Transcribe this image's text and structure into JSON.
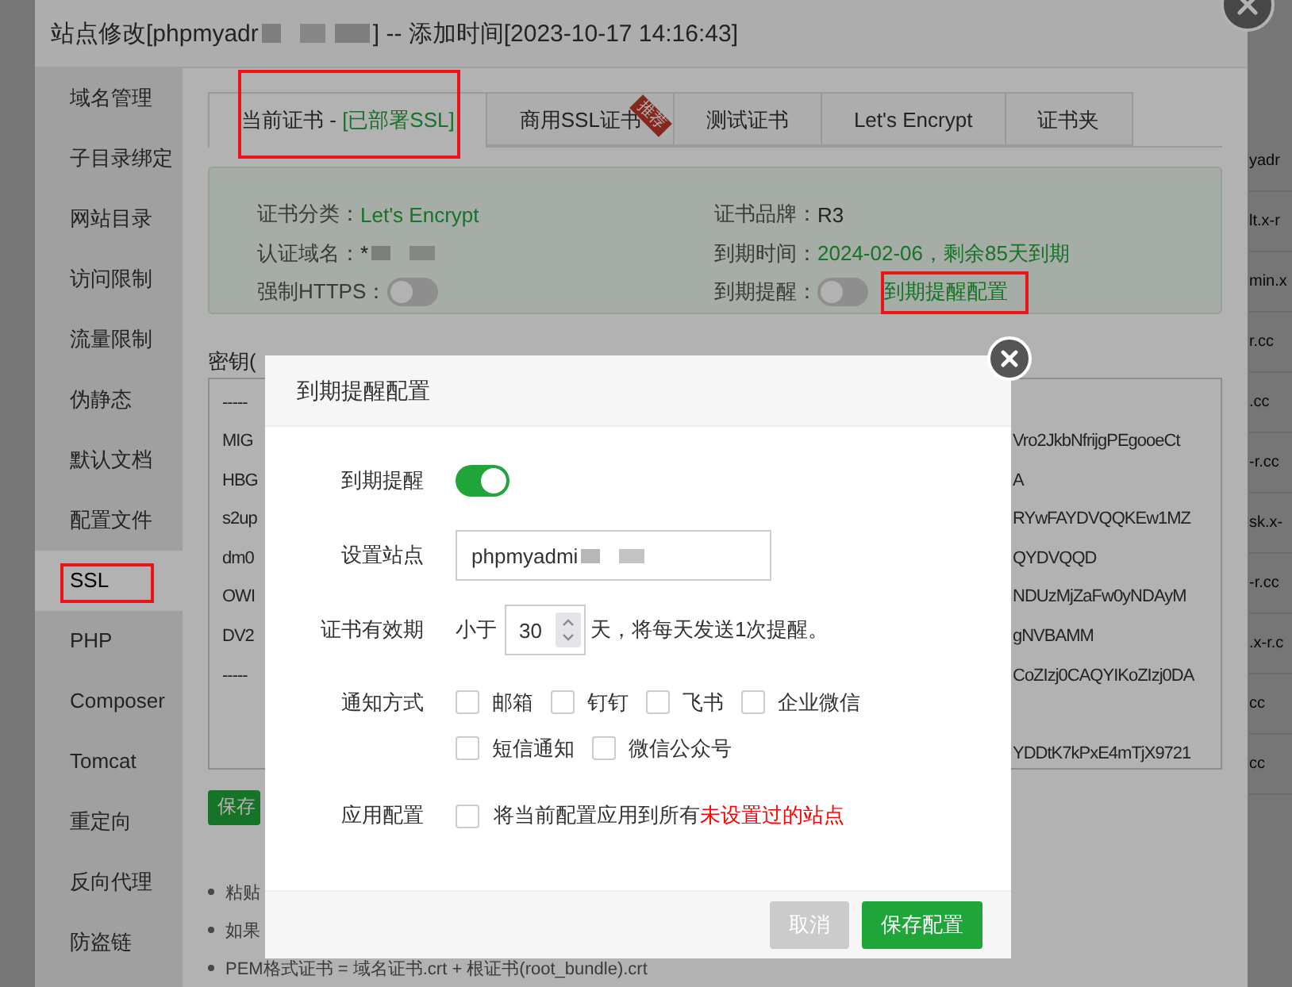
{
  "background_table": {
    "cells": [
      "yadr",
      "lt.x-r",
      "min.x",
      "r.cc",
      ".cc",
      "-r.cc",
      "sk.x-",
      "-r.cc",
      ".x-r.c",
      "cc",
      "cc"
    ]
  },
  "site_dialog": {
    "title": "站点修改[phpmyadr",
    "title_tail": "] -- 添加时间[2023-10-17 14:16:43]",
    "sidebar": {
      "items": [
        {
          "label": "域名管理",
          "selected": false
        },
        {
          "label": "子目录绑定",
          "selected": false
        },
        {
          "label": "网站目录",
          "selected": false
        },
        {
          "label": "访问限制",
          "selected": false
        },
        {
          "label": "流量限制",
          "selected": false
        },
        {
          "label": "伪静态",
          "selected": false
        },
        {
          "label": "默认文档",
          "selected": false
        },
        {
          "label": "配置文件",
          "selected": false
        },
        {
          "label": "SSL",
          "selected": true
        },
        {
          "label": "PHP",
          "selected": false
        },
        {
          "label": "Composer",
          "selected": false
        },
        {
          "label": "Tomcat",
          "selected": false
        },
        {
          "label": "重定向",
          "selected": false
        },
        {
          "label": "反向代理",
          "selected": false
        },
        {
          "label": "防盗链",
          "selected": false
        }
      ]
    },
    "tabs": [
      {
        "label": "当前证书 - ",
        "status": "[已部署SSL]",
        "selected": true
      },
      {
        "label": "商用SSL证书",
        "badge": "推荐",
        "selected": false
      },
      {
        "label": "测试证书",
        "selected": false
      },
      {
        "label": "Let's Encrypt",
        "selected": false
      },
      {
        "label": "证书夹",
        "selected": false
      }
    ],
    "cert_info": {
      "fields": [
        {
          "kind": "status",
          "label": "证书分类：",
          "value": "Let's Encrypt"
        },
        {
          "kind": "plain",
          "label": "证书品牌：",
          "value": "R3"
        },
        {
          "kind": "masked",
          "label": "认证域名：",
          "value": "*"
        },
        {
          "kind": "status",
          "label": "到期时间：",
          "value": "2024-02-06，剩余85天到期"
        },
        {
          "kind": "toggle",
          "label": "强制HTTPS：",
          "on": false
        },
        {
          "kind": "toggle",
          "label": "到期提醒：",
          "on": false,
          "link": "到期提醒配置"
        }
      ]
    },
    "key_label": "密钥(",
    "key_lines": [
      {
        "left": "-----"
      },
      {
        "left": "MIG",
        "right": "Vro2JkbNfrijgPEgooeCt"
      },
      {
        "left": "HBG",
        "right": "A"
      },
      {
        "left": "s2up",
        "right": "RYwFAYDVQQKEw1MZ"
      },
      {
        "left": "dm0",
        "right": "QYDVQQD"
      },
      {
        "left": "OWI",
        "right": "NDUzMjZaFw0yNDAyM"
      },
      {
        "left": "DV2",
        "right": "gNVBAMM"
      },
      {
        "left": "-----",
        "right": "CoZIzj0CAQYIKoZIzj0DA"
      },
      {
        "right": "YDDtK7kPxE4mTjX9721"
      }
    ],
    "save_button": "保存",
    "notes": [
      "粘贴",
      "如果",
      "PEM格式证书 = 域名证书.crt + 根证书(root_bundle).crt"
    ]
  },
  "modal": {
    "title": "到期提醒配置",
    "reminder": {
      "label": "到期提醒",
      "on": true
    },
    "site": {
      "label": "设置站点",
      "value": "phpmyadmi"
    },
    "validity": {
      "label": "证书有效期",
      "prefix": "小于",
      "days": "30",
      "suffix": "天，将每天发送1次提醒。"
    },
    "notify": {
      "label": "通知方式",
      "options": [
        {
          "label": "邮箱",
          "checked": false
        },
        {
          "label": "钉钉",
          "checked": false
        },
        {
          "label": "飞书",
          "checked": false
        },
        {
          "label": "企业微信",
          "checked": false
        },
        {
          "label": "短信通知",
          "checked": false
        },
        {
          "label": "微信公众号",
          "checked": false
        }
      ]
    },
    "apply": {
      "label": "应用配置",
      "checked": false,
      "text": "将当前配置应用到所有",
      "highlight": "未设置过的站点"
    },
    "buttons": [
      {
        "label": "取消",
        "kind": "cancel"
      },
      {
        "label": "保存配置",
        "kind": "primary"
      }
    ]
  }
}
